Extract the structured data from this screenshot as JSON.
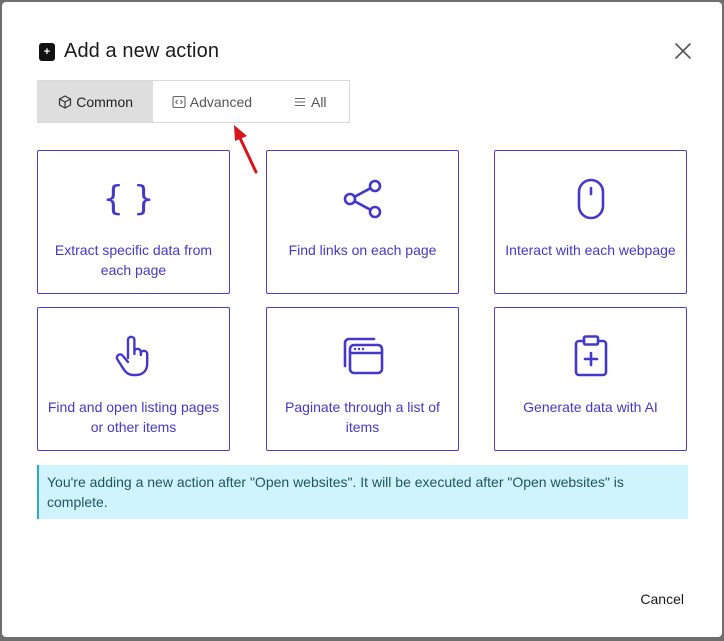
{
  "dialog": {
    "title": "Add a new action",
    "title_icon": "+",
    "close_icon": "close-icon"
  },
  "tabs": [
    {
      "label": "Common",
      "icon": "cube-icon",
      "active": true
    },
    {
      "label": "Advanced",
      "icon": "code-icon",
      "active": false
    },
    {
      "label": "All",
      "icon": "list-icon",
      "active": false
    }
  ],
  "cards": [
    {
      "label": "Extract specific data from each page",
      "icon": "braces-icon"
    },
    {
      "label": "Find links on each page",
      "icon": "share-icon"
    },
    {
      "label": "Interact with each webpage",
      "icon": "mouse-icon"
    },
    {
      "label": "Find and open listing pages or other items",
      "icon": "pointer-hand-icon"
    },
    {
      "label": "Paginate through a list of items",
      "icon": "windows-stack-icon"
    },
    {
      "label": "Generate data with AI",
      "icon": "clipboard-plus-icon"
    }
  ],
  "info": {
    "text": "You're adding a new action after \"Open websites\". It will be executed after \"Open websites\" is complete."
  },
  "footer": {
    "cancel_label": "Cancel"
  },
  "colors": {
    "accent": "#4338ca",
    "info_bg": "#cff4fc",
    "arrow": "#d9141b"
  }
}
